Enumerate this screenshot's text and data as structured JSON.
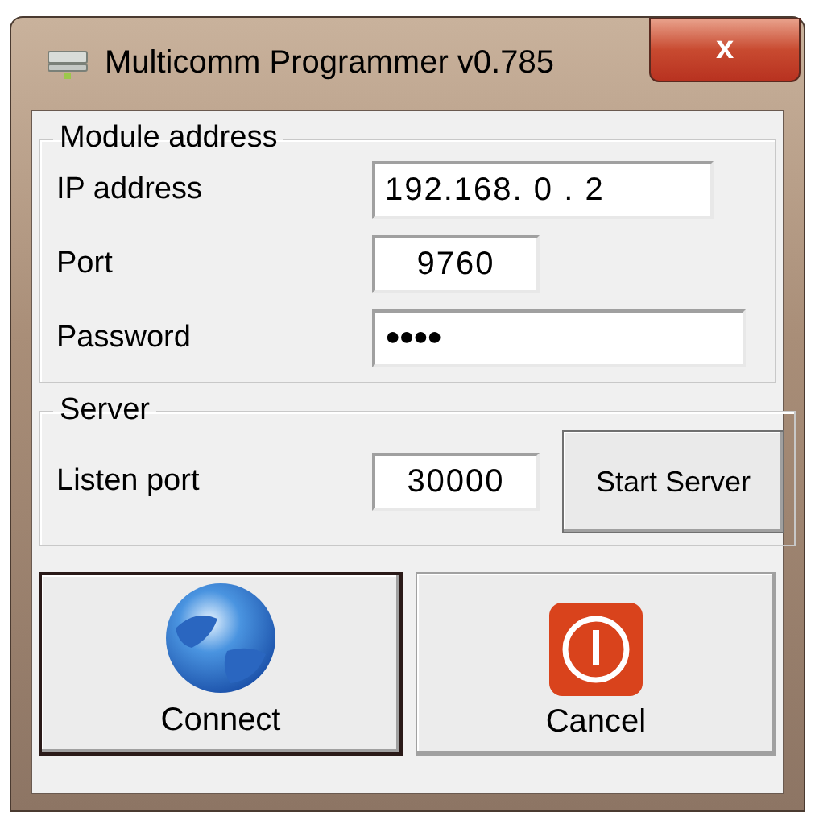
{
  "window": {
    "title": "Multicomm Programmer v0.785",
    "close_label": "x"
  },
  "module_address": {
    "title": "Module address",
    "fields": [
      {
        "label": "IP address",
        "value": "192.168. 0 . 2",
        "kind": "wide"
      },
      {
        "label": "Port",
        "value": "9760",
        "kind": "short"
      },
      {
        "label": "Password",
        "value": "●●●●",
        "kind": "long"
      }
    ]
  },
  "server": {
    "title": "Server",
    "label": "Listen port",
    "value": "30000",
    "button": "Start Server"
  },
  "buttons": [
    {
      "label": "Connect",
      "kind": "connect",
      "default": true
    },
    {
      "label": "Cancel",
      "kind": "cancel",
      "default": false
    }
  ]
}
